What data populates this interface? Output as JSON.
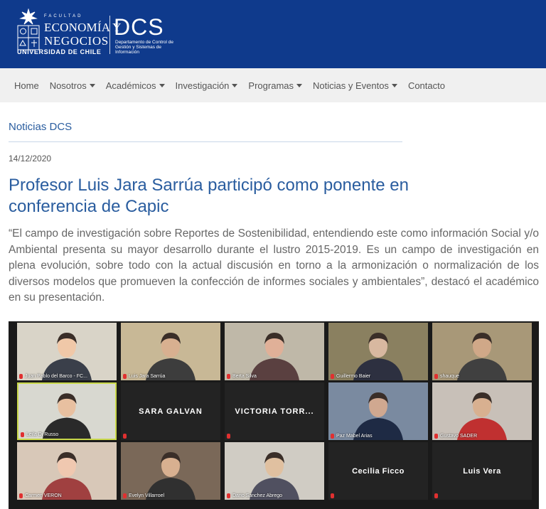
{
  "header": {
    "facultad": "FACULTAD",
    "line1": "ECONOMÍA Y",
    "line2": "NEGOCIOS",
    "university": "UNIVERSIDAD DE CHILE",
    "brand": "DCS",
    "brand_sub": "Departamento de Control de Gestión y Sistemas de Información",
    "colors": {
      "header_bg": "#0f3a8c",
      "nav_bg": "#f0f0f0",
      "link": "#2a5d9f"
    }
  },
  "nav": {
    "items": [
      {
        "label": "Home",
        "dropdown": false
      },
      {
        "label": "Nosotros",
        "dropdown": true
      },
      {
        "label": "Académicos",
        "dropdown": true
      },
      {
        "label": "Investigación",
        "dropdown": true
      },
      {
        "label": "Programas",
        "dropdown": true
      },
      {
        "label": "Noticias y Eventos",
        "dropdown": true
      },
      {
        "label": "Contacto",
        "dropdown": false
      }
    ]
  },
  "page": {
    "section_title": "Noticias DCS",
    "date": "14/12/2020",
    "title": "Profesor Luis Jara Sarrúa participó como ponente en conferencia de Capic",
    "lead": "“El campo de investigación sobre Reportes de Sostenibilidad, entendiendo este como información Social y/o Ambiental presenta su mayor desarrollo durante el lustro 2015-2019. Es un campo de investigación en plena evolución, sobre todo con la actual discusión en torno a la armonización o normalización de los diversos modelos que promueven la confección de informes sociales y ambientales”, destacó el académico en su presentación."
  },
  "video": {
    "participants": [
      {
        "name": "Juan Pablo del Barco - FC...",
        "type": "video"
      },
      {
        "name": "Luis Jara Sarrúa",
        "type": "video"
      },
      {
        "name": "Berta Silva",
        "type": "video"
      },
      {
        "name": "Guillermo Baier",
        "type": "video"
      },
      {
        "name": "shauque",
        "type": "video"
      },
      {
        "name": "Leila Di Russo",
        "type": "video",
        "active": true
      },
      {
        "name": "SARA GALVAN",
        "type": "name"
      },
      {
        "name": "VICTORIA  TORR...",
        "type": "name"
      },
      {
        "name": "Paz Mabel Arias",
        "type": "video"
      },
      {
        "name": "Gustavo SADER",
        "type": "video"
      },
      {
        "name": "Carmen VERON",
        "type": "video"
      },
      {
        "name": "Evelyn Villarroel",
        "type": "video"
      },
      {
        "name": "Dario Sanchez Abrego",
        "type": "video"
      },
      {
        "name": "Cecilia Ficco",
        "type": "name"
      },
      {
        "name": "Luis  Vera",
        "type": "name"
      }
    ]
  }
}
